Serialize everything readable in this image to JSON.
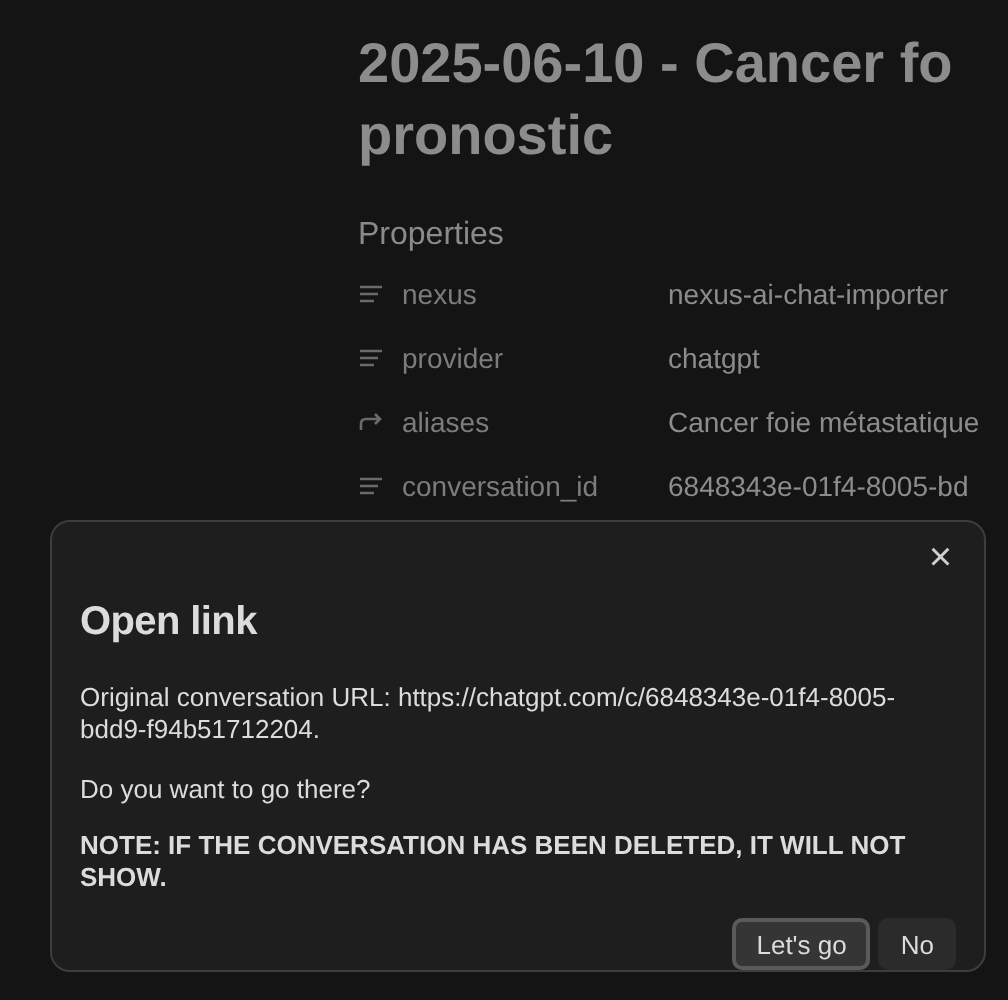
{
  "note": {
    "title_lines": [
      "2025-06-10 - Cancer fo",
      "pronostic"
    ],
    "properties_heading": "Properties",
    "properties": [
      {
        "kind": "text",
        "name": "nexus",
        "value": "nexus-ai-chat-importer"
      },
      {
        "kind": "text",
        "name": "provider",
        "value": "chatgpt"
      },
      {
        "kind": "alias",
        "name": "aliases",
        "value": "Cancer foie métastatique"
      },
      {
        "kind": "text",
        "name": "conversation_id",
        "value": "6848343e-01f4-8005-bd"
      }
    ]
  },
  "dialog": {
    "close": "×",
    "title": "Open link",
    "paragraphs": [
      {
        "kind": "plain",
        "text": "Original conversation URL: https://chatgpt.com/c/6848343e-01f4-8005-bdd9-f94b51712204."
      },
      {
        "kind": "plain",
        "text": "Do you want to go there?"
      },
      {
        "kind": "strong",
        "text": "NOTE: IF THE CONVERSATION HAS BEEN DELETED, IT WILL NOT SHOW."
      }
    ],
    "buttons": [
      {
        "label": "Let's go",
        "selected": true
      },
      {
        "label": "No",
        "selected": false
      }
    ]
  }
}
